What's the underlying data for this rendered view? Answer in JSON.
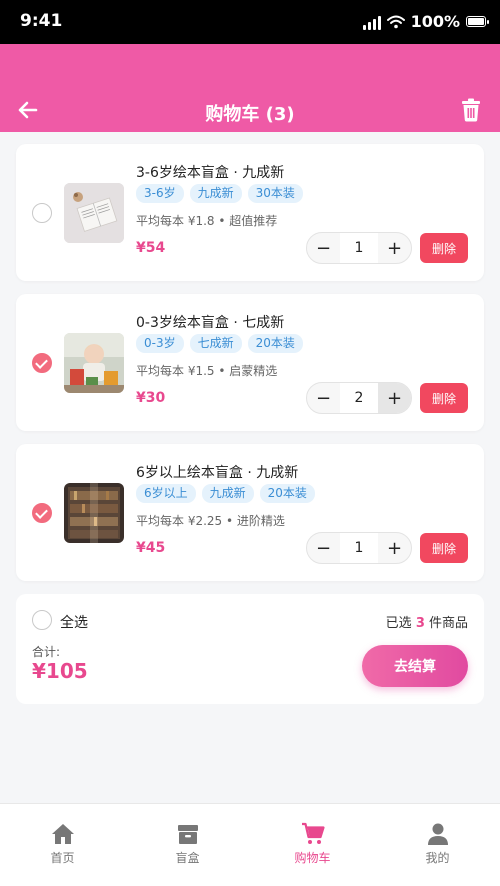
{
  "status_bar": {
    "time": "9:41",
    "battery": "100%"
  },
  "header": {
    "title": "购物车 (3)"
  },
  "cart": {
    "items": [
      {
        "title": "3-6岁绘本盲盒 · 九成新",
        "tags": [
          "3-6岁",
          "九成新",
          "30本装"
        ],
        "subtitle": "平均每本 ¥1.8 • 超值推荐",
        "price": "¥54",
        "quantity": "1",
        "checked": false,
        "delete_label": "删除"
      },
      {
        "title": "0-3岁绘本盲盒 · 七成新",
        "tags": [
          "0-3岁",
          "七成新",
          "20本装"
        ],
        "subtitle": "平均每本 ¥1.5 • 启蒙精选",
        "price": "¥30",
        "quantity": "2",
        "checked": true,
        "delete_label": "删除"
      },
      {
        "title": "6岁以上绘本盲盒 · 九成新",
        "tags": [
          "6岁以上",
          "九成新",
          "20本装"
        ],
        "subtitle": "平均每本 ¥2.25 • 进阶精选",
        "price": "¥45",
        "quantity": "1",
        "checked": true,
        "delete_label": "删除"
      }
    ]
  },
  "summary": {
    "select_all_label": "全选",
    "selected_prefix": "已选 ",
    "selected_count": "3",
    "selected_suffix": " 件商品",
    "total_label": "合计:",
    "total_value": "¥105",
    "checkout_label": "去结算"
  },
  "tabbar": {
    "tabs": [
      {
        "label": "首页",
        "icon": "home-icon"
      },
      {
        "label": "盲盒",
        "icon": "box-icon"
      },
      {
        "label": "购物车",
        "icon": "cart-icon",
        "active": true
      },
      {
        "label": "我的",
        "icon": "user-icon"
      }
    ]
  },
  "colors": {
    "brand": "#ef5aa6",
    "price": "#e8488e",
    "delete": "#f1485f",
    "check": "#f26b7e",
    "tag_text": "#3b8ed4",
    "tag_bg": "#e5f2fc"
  }
}
